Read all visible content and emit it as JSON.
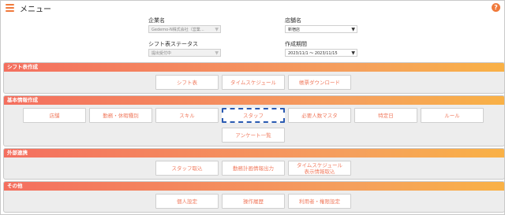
{
  "header": {
    "title": "メニュー"
  },
  "form": {
    "company": {
      "label": "企業名",
      "value": "Gedemo-N株式会社（営業…"
    },
    "store": {
      "label": "店舗名",
      "value": "新宿店"
    },
    "shift_status": {
      "label": "シフト表ステータス",
      "value": "提出受付中"
    },
    "period": {
      "label": "作成期間",
      "value": "2023/11/1 ～ 2023/11/15"
    }
  },
  "sections": {
    "shift": {
      "title": "シフト表作成",
      "buttons": [
        "シフト表",
        "タイムスケジュール",
        "帳票ダウンロード"
      ]
    },
    "basic": {
      "title": "基本情報作成",
      "buttons": [
        "店舗",
        "勤務・休暇種別",
        "スキル",
        "スタッフ",
        "必要人数マスタ",
        "特定日",
        "ルール",
        "アンケート一覧"
      ]
    },
    "external": {
      "title": "外部連携",
      "buttons": [
        "スタッフ取込",
        "勤務計画情報出力",
        "タイムスケジュール",
        "表示情報取込"
      ]
    },
    "other": {
      "title": "その他",
      "buttons": [
        "個人設定",
        "操作履歴",
        "利用者・権限設定"
      ]
    }
  },
  "colors": {
    "accent": "#f07a3c",
    "header_start": "#f46f5f",
    "header_end": "#f9b146",
    "active_border": "#2a5ab2"
  },
  "icons": {
    "menu": "hamburger-icon",
    "help": "help-icon",
    "dropdown": "chevron-down-icon"
  }
}
